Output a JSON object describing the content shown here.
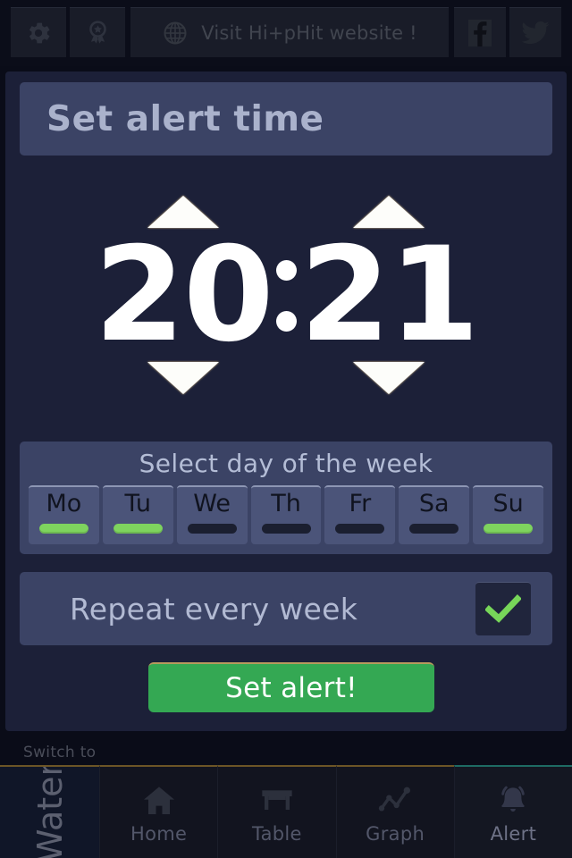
{
  "topbar": {
    "gear_icon": "gear-icon",
    "award_icon": "award-icon",
    "globe_icon": "globe-icon",
    "website_text": "Visit Hi+pHit website !",
    "facebook_icon": "facebook-icon",
    "twitter_icon": "twitter-icon"
  },
  "header": {
    "title": "Set alert time"
  },
  "time_picker": {
    "hour": "20",
    "minute": "21",
    "separator": ":",
    "hour_up_label": "increase-hour",
    "hour_down_label": "decrease-hour",
    "minute_up_label": "increase-minute",
    "minute_down_label": "decrease-minute"
  },
  "day_selector": {
    "label": "Select day of the week",
    "days": [
      {
        "name": "Mo",
        "selected": true
      },
      {
        "name": "Tu",
        "selected": true
      },
      {
        "name": "We",
        "selected": false
      },
      {
        "name": "Th",
        "selected": false
      },
      {
        "name": "Fr",
        "selected": false
      },
      {
        "name": "Sa",
        "selected": false
      },
      {
        "name": "Su",
        "selected": true
      }
    ]
  },
  "repeat": {
    "label": "Repeat every week",
    "checked": true
  },
  "action": {
    "set_alert_label": "Set alert!"
  },
  "bottom": {
    "switch_to_label": "Switch to",
    "water_tab_label": "Water",
    "tabs": [
      {
        "label": "Home",
        "icon": "home-icon",
        "active": false
      },
      {
        "label": "Table",
        "icon": "table-icon",
        "active": false
      },
      {
        "label": "Graph",
        "icon": "graph-icon",
        "active": false
      },
      {
        "label": "Alert",
        "icon": "bell-icon",
        "active": true
      }
    ]
  },
  "colors": {
    "accent_green": "#34a853",
    "indicator_green": "#7ed45e",
    "panel": "#1c2038",
    "card": "#3b4365",
    "active_tab_border": "#1e6b63"
  }
}
